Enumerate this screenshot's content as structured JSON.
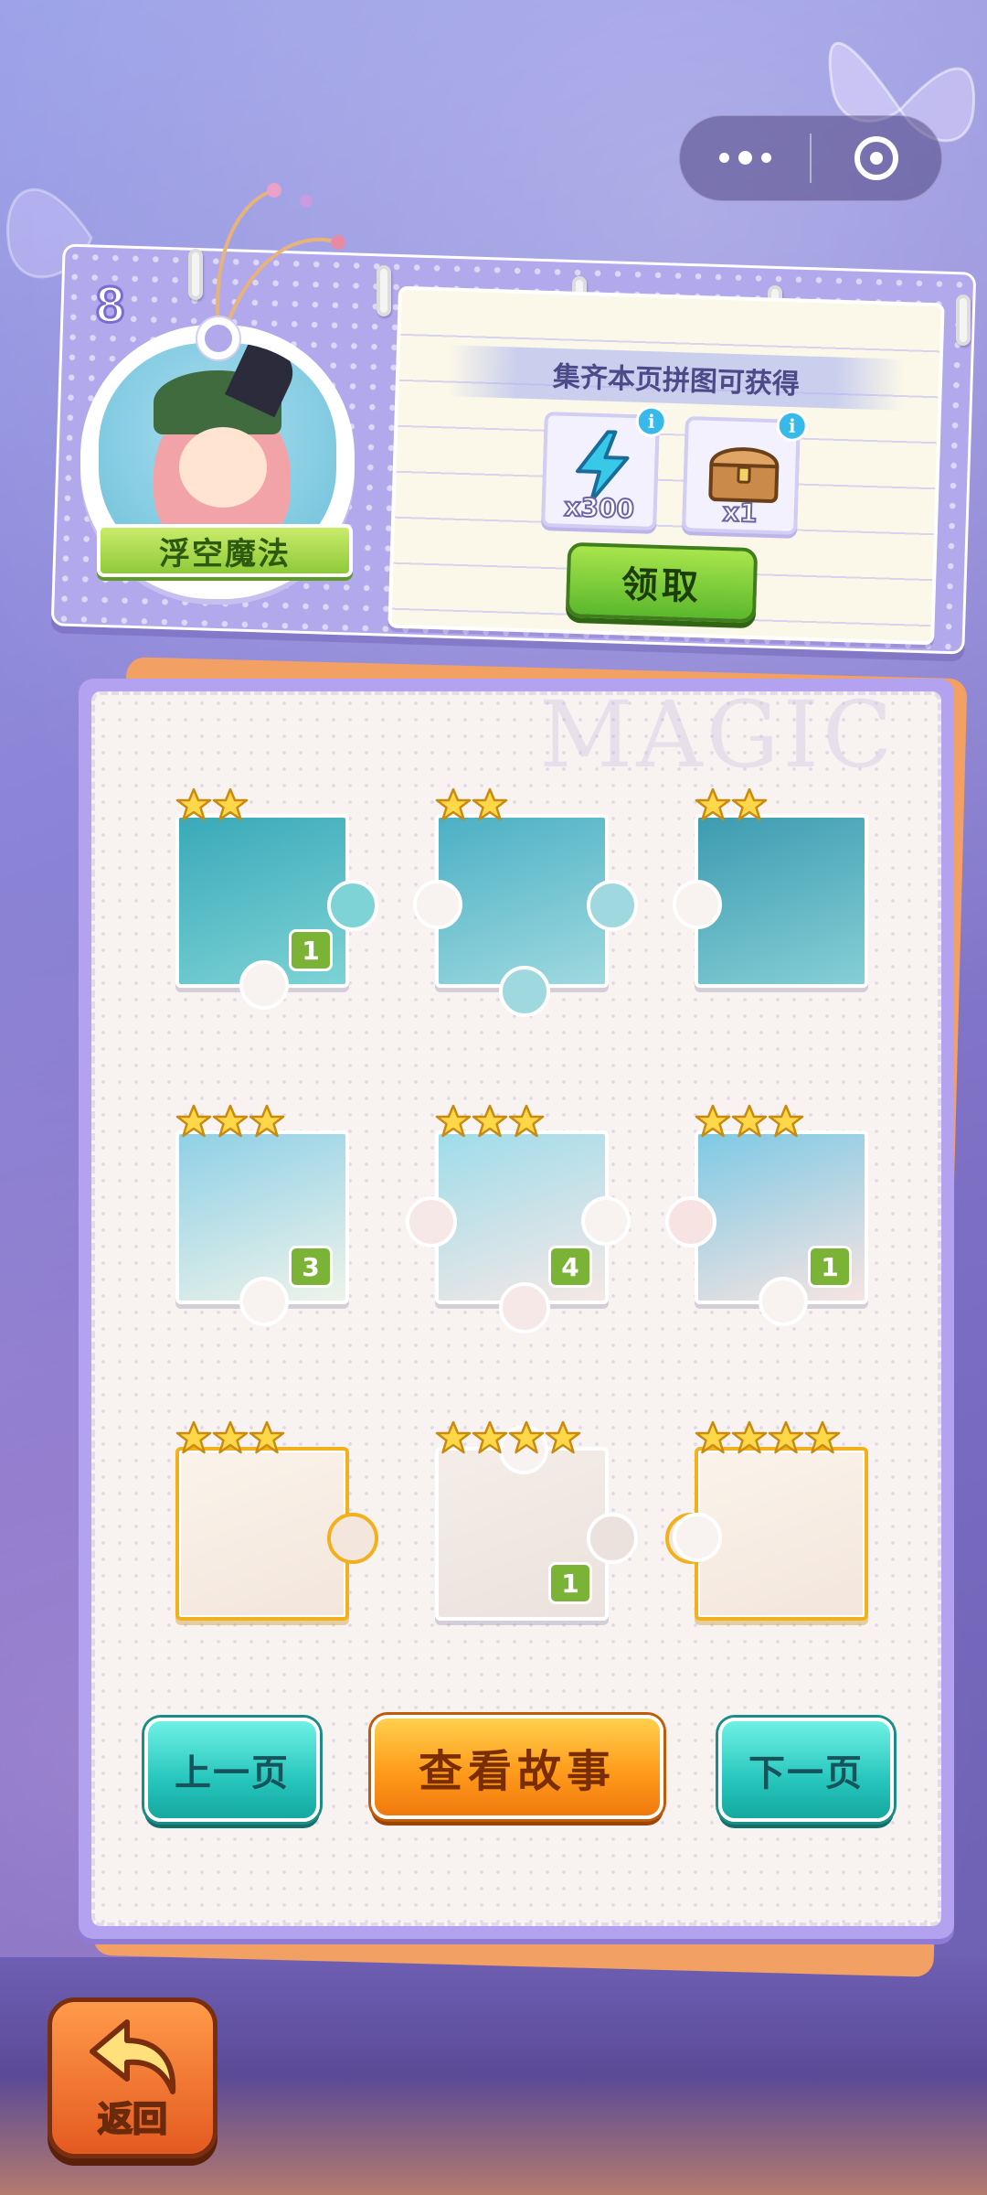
{
  "capsule": {
    "more_icon": "more-dots-icon",
    "close_icon": "target-icon"
  },
  "page": {
    "number": "8"
  },
  "character": {
    "name": "浮空魔法"
  },
  "reward": {
    "title": "集齐本页拼图可获得",
    "items": [
      {
        "icon": "energy-bolt-icon",
        "qty": "x300",
        "info_icon": "info-icon"
      },
      {
        "icon": "treasure-chest-icon",
        "qty": "x1",
        "info_icon": "info-icon"
      }
    ],
    "claim_label": "领取"
  },
  "board": {
    "watermark": "MAGIC",
    "pieces": [
      {
        "stars": 2,
        "count": "1",
        "gold": false
      },
      {
        "stars": 2,
        "count": "",
        "gold": false
      },
      {
        "stars": 2,
        "count": "",
        "gold": false
      },
      {
        "stars": 3,
        "count": "3",
        "gold": false
      },
      {
        "stars": 3,
        "count": "4",
        "gold": false
      },
      {
        "stars": 3,
        "count": "1",
        "gold": false
      },
      {
        "stars": 3,
        "count": "",
        "gold": true
      },
      {
        "stars": 4,
        "count": "1",
        "gold": false
      },
      {
        "stars": 4,
        "count": "",
        "gold": true
      }
    ]
  },
  "nav": {
    "prev_label": "上一页",
    "story_label": "查看故事",
    "next_label": "下一页"
  },
  "back": {
    "label": "返回",
    "icon": "back-arrow-icon"
  },
  "colors": {
    "teal": "#27c6bd",
    "orange": "#ff9b1c",
    "green": "#7bb336",
    "gold": "#f2b11c",
    "lavender": "#b3a2ef"
  }
}
